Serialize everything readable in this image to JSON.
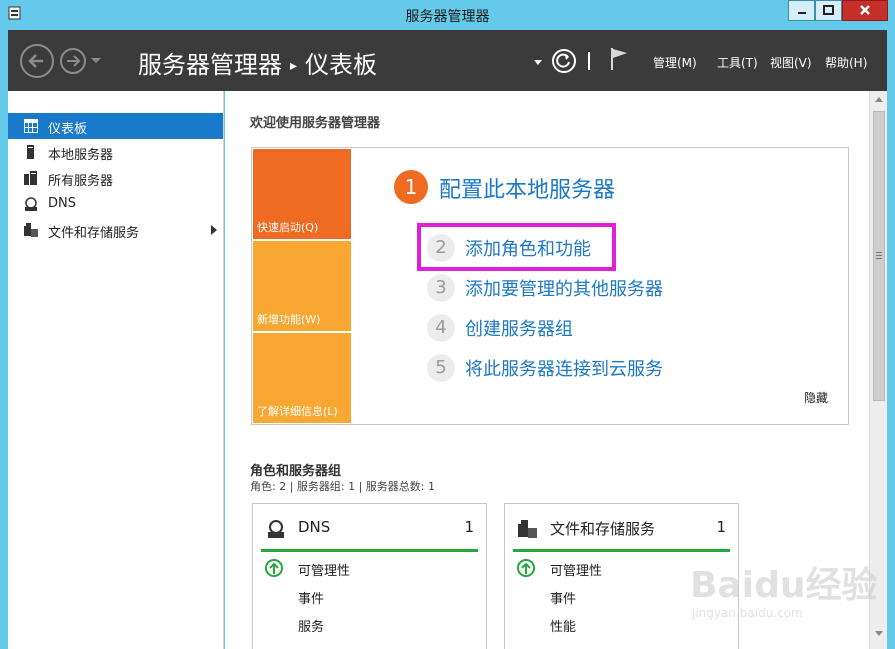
{
  "window": {
    "title": "服务器管理器"
  },
  "header": {
    "breadcrumb_root": "服务器管理器",
    "breadcrumb_sep": "▸",
    "breadcrumb_current": "仪表板",
    "menus": {
      "manage": "管理(M)",
      "tools": "工具(T)",
      "view": "视图(V)",
      "help": "帮助(H)"
    }
  },
  "sidebar": {
    "items": [
      {
        "label": "仪表板",
        "icon": "dashboard-icon",
        "active": true
      },
      {
        "label": "本地服务器",
        "icon": "local-server-icon",
        "active": false
      },
      {
        "label": "所有服务器",
        "icon": "all-servers-icon",
        "active": false
      },
      {
        "label": "DNS",
        "icon": "dns-icon",
        "active": false
      },
      {
        "label": "文件和存储服务",
        "icon": "file-storage-icon",
        "active": false
      }
    ]
  },
  "main": {
    "welcome_heading": "欢迎使用服务器管理器",
    "tiles": {
      "quick_start": "快速启动(Q)",
      "whats_new": "新增功能(W)",
      "learn_more": "了解详细信息(L)"
    },
    "steps": [
      {
        "num": "1",
        "label": "配置此本地服务器"
      },
      {
        "num": "2",
        "label": "添加角色和功能"
      },
      {
        "num": "3",
        "label": "添加要管理的其他服务器"
      },
      {
        "num": "4",
        "label": "创建服务器组"
      },
      {
        "num": "5",
        "label": "将此服务器连接到云服务"
      }
    ],
    "hide_label": "隐藏",
    "roles_heading": "角色和服务器组",
    "roles_summary": "角色: 2 | 服务器组: 1 | 服务器总数: 1",
    "role_cards": [
      {
        "title": "DNS",
        "count": "1",
        "rows": [
          "可管理性",
          "事件",
          "服务"
        ]
      },
      {
        "title": "文件和存储服务",
        "count": "1",
        "rows": [
          "可管理性",
          "事件",
          "性能"
        ]
      }
    ]
  },
  "watermark": {
    "logo": "Baidu经验",
    "url": "jingyan.baidu.com"
  },
  "colors": {
    "accent_blue": "#1979ca",
    "tile_orange": "#f06b22",
    "tile_amber": "#f8a733",
    "status_green": "#26a83c",
    "highlight_magenta": "#e020d8",
    "header_dark": "#3b3b3b"
  }
}
